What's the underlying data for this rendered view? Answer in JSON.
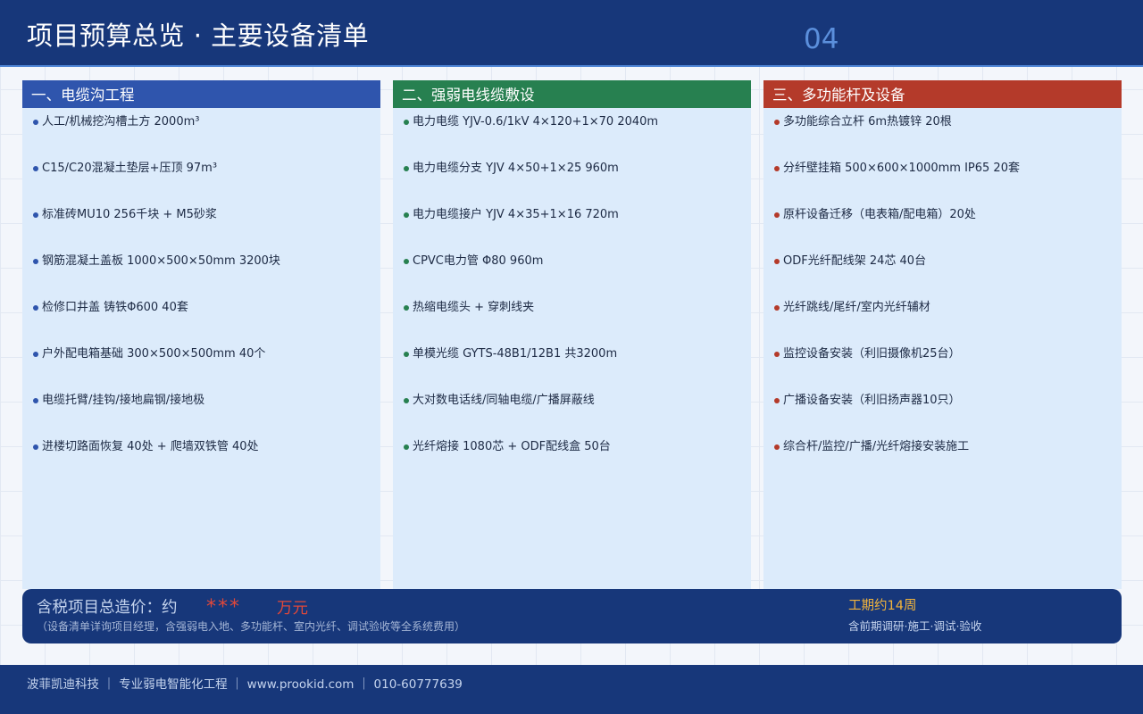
{
  "header": {
    "title": "项目预算总览 · 主要设备清单",
    "page_number": "04"
  },
  "panels": [
    {
      "title": "一、电缆沟工程",
      "color": "#2f55ad",
      "items": [
        "人工/机械挖沟槽土方 2000m³",
        "C15/C20混凝土垫层+压顶 97m³",
        "标准砖MU10 256千块 + M5砂浆",
        "钢筋混凝土盖板 1000×500×50mm 3200块",
        "检修口井盖 铸铁Φ600 40套",
        "户外配电箱基础 300×500×500mm 40个",
        "电缆托臂/挂钩/接地扁钢/接地极",
        "进楼切路面恢复 40处 + 爬墙双铁管 40处"
      ]
    },
    {
      "title": "二、强弱电线缆敷设",
      "color": "#278050",
      "items": [
        "电力电缆 YJV-0.6/1kV 4×120+1×70 2040m",
        "电力电缆分支 YJV 4×50+1×25 960m",
        "电力电缆接户 YJV 4×35+1×16 720m",
        "CPVC电力管 Φ80 960m",
        "热缩电缆头 + 穿刺线夹",
        "单模光缆 GYTS-48B1/12B1 共3200m",
        "大对数电话线/同轴电缆/广播屏蔽线",
        "光纤熔接 1080芯 + ODF配线盒 50台"
      ]
    },
    {
      "title": "三、多功能杆及设备",
      "color": "#b43a2a",
      "items": [
        "多功能综合立杆 6m热镀锌 20根",
        "分纤壁挂箱 500×600×1000mm IP65 20套",
        "原杆设备迁移（电表箱/配电箱）20处",
        "ODF光纤配线架 24芯 40台",
        "光纤跳线/尾纤/室内光纤辅材",
        "监控设备安装（利旧摄像机25台）",
        "广播设备安装（利旧扬声器10只）",
        "综合杆/监控/广播/光纤熔接安装施工"
      ]
    }
  ],
  "summary": {
    "cost_label": "含税项目总造价：约",
    "cost_value": "***",
    "cost_unit": "万元",
    "cost_note": "（设备清单详询项目经理，含强弱电入地、多功能杆、室内光纤、调试验收等全系统费用）",
    "period": "工期约14周",
    "period_note": "含前期调研·施工·调试·验收"
  },
  "footer": {
    "text": "波菲凯迪科技 ｜ 专业弱电智能化工程 ｜ www.prookid.com ｜ 010-60777639"
  },
  "colors": {
    "navy": "#17377a",
    "accent_red": "#e0483a",
    "accent_gold": "#f2b43c",
    "panel_bg": "#dcebfb"
  }
}
